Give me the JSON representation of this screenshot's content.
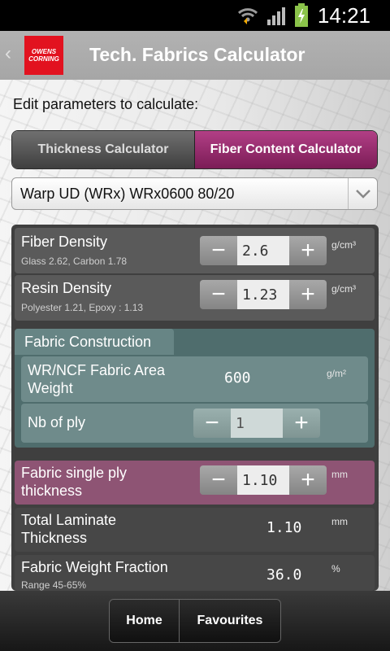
{
  "status_bar": {
    "time": "14:21"
  },
  "app": {
    "title": "Tech. Fabrics Calculator",
    "logo_line1": "OWENS",
    "logo_line2": "CORNING"
  },
  "subtitle": "Edit parameters to calculate:",
  "tabs": [
    {
      "label": "Thickness Calculator",
      "active": false
    },
    {
      "label": "Fiber Content Calculator",
      "active": true
    }
  ],
  "fabric_select": {
    "value": "Warp UD (WRx) WRx0600 80/20"
  },
  "fiber_density": {
    "label": "Fiber Density",
    "hint": "Glass 2.62, Carbon 1.78",
    "value": "2.6",
    "unit": "g/cm³"
  },
  "resin_density": {
    "label": "Resin Density",
    "hint": "Polyester 1.21, Epoxy : 1.13",
    "value": "1.23",
    "unit": "g/cm³"
  },
  "fabric_construction": {
    "tab_label": "Fabric Construction",
    "area_weight": {
      "label": "WR/NCF Fabric Area Weight",
      "value": "600",
      "unit": "g/m²"
    },
    "nb_ply": {
      "label": "Nb of ply",
      "value": "1"
    }
  },
  "single_ply": {
    "label": "Fabric single ply thickness",
    "value": "1.10",
    "unit": "mm"
  },
  "total_thickness": {
    "label": "Total Laminate Thickness",
    "value": "1.10",
    "unit": "mm"
  },
  "weight_fraction": {
    "label": "Fabric Weight Fraction",
    "hint": "Range 45-65%",
    "value": "36.0",
    "unit": "%"
  },
  "bottom_nav": {
    "home": "Home",
    "favourites": "Favourites"
  },
  "colors": {
    "accent": "#8e1f62",
    "brand_red": "#e2121f",
    "panel": "#3f3f3f"
  },
  "icons": [
    "wifi-icon",
    "signal-icon",
    "battery-icon",
    "back-chevron-icon",
    "chevron-down-icon",
    "minus-icon",
    "plus-icon"
  ]
}
